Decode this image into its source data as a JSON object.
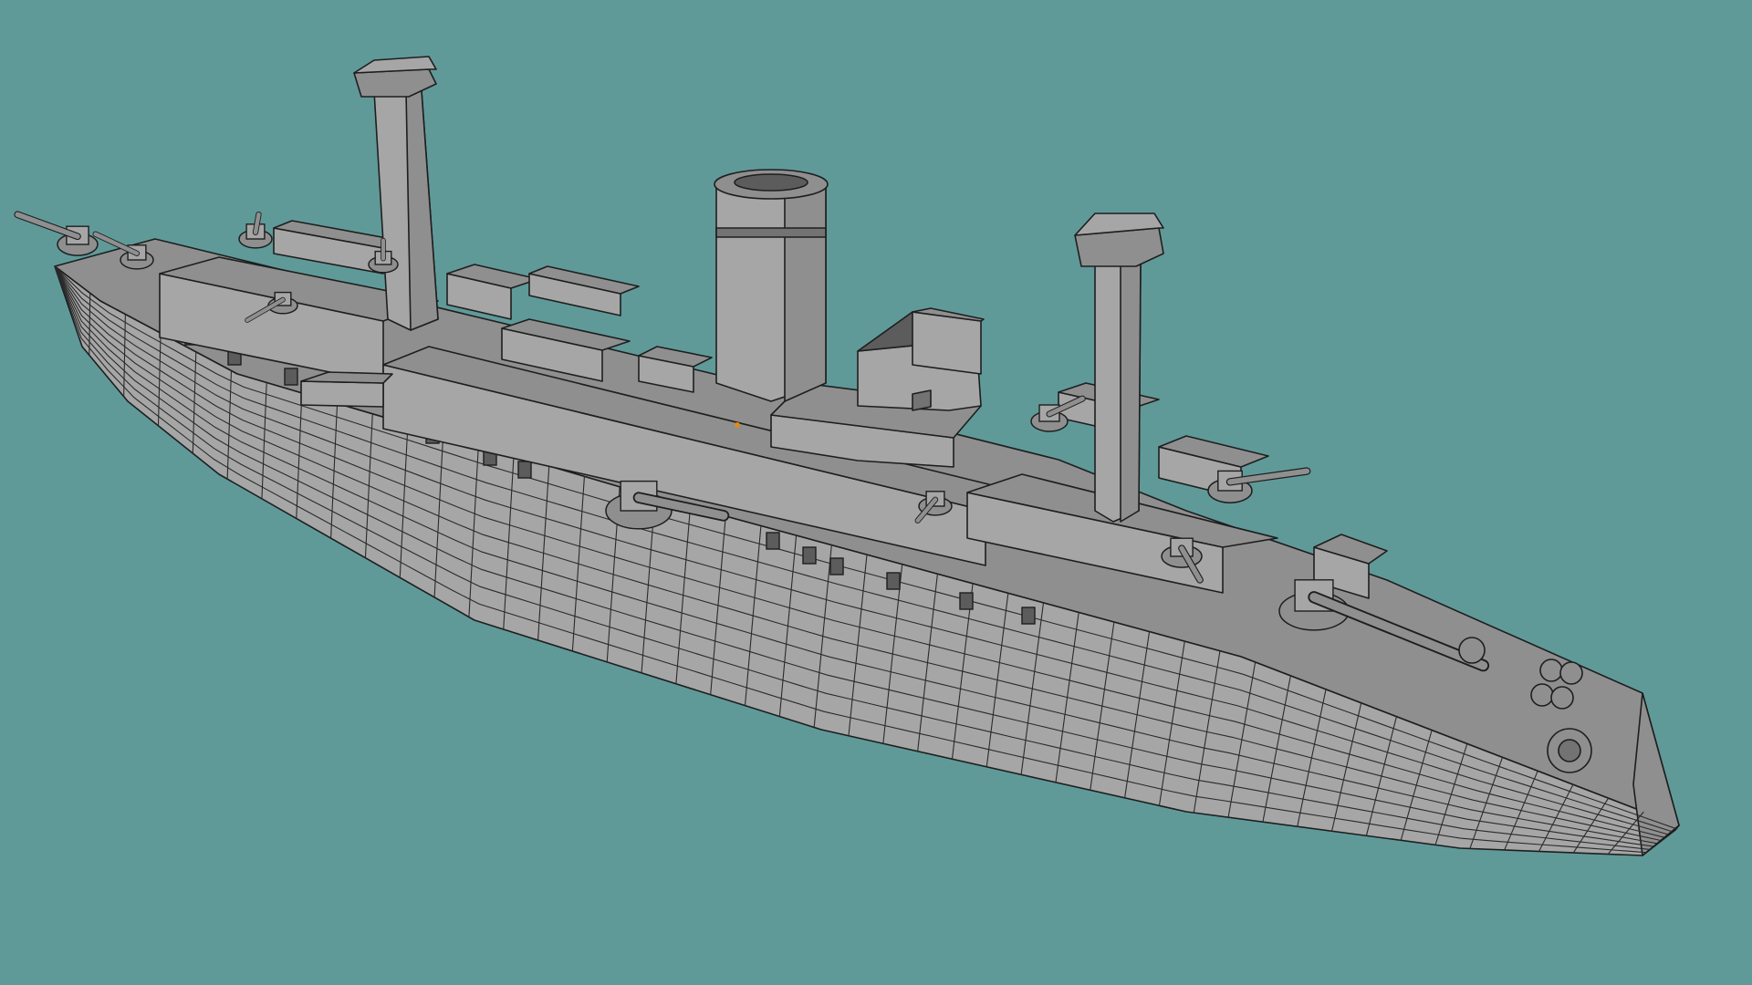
{
  "viewport": {
    "background_color": "#5f9a99",
    "mesh_light": "#a6a6a6",
    "mesh_mid": "#8f8f8f",
    "mesh_dark": "#737373",
    "mesh_shadow": "#5c5c5c",
    "wire_color": "#2a2a2a",
    "origin_point_color": "#e08a1a"
  },
  "model": {
    "mode": "edit-mode-wireframe-overlay",
    "objects": [
      "hull",
      "superstructure",
      "funnel-main",
      "mast-fore",
      "mast-aft",
      "bridge",
      "deck-guns",
      "bow-anchors"
    ]
  }
}
